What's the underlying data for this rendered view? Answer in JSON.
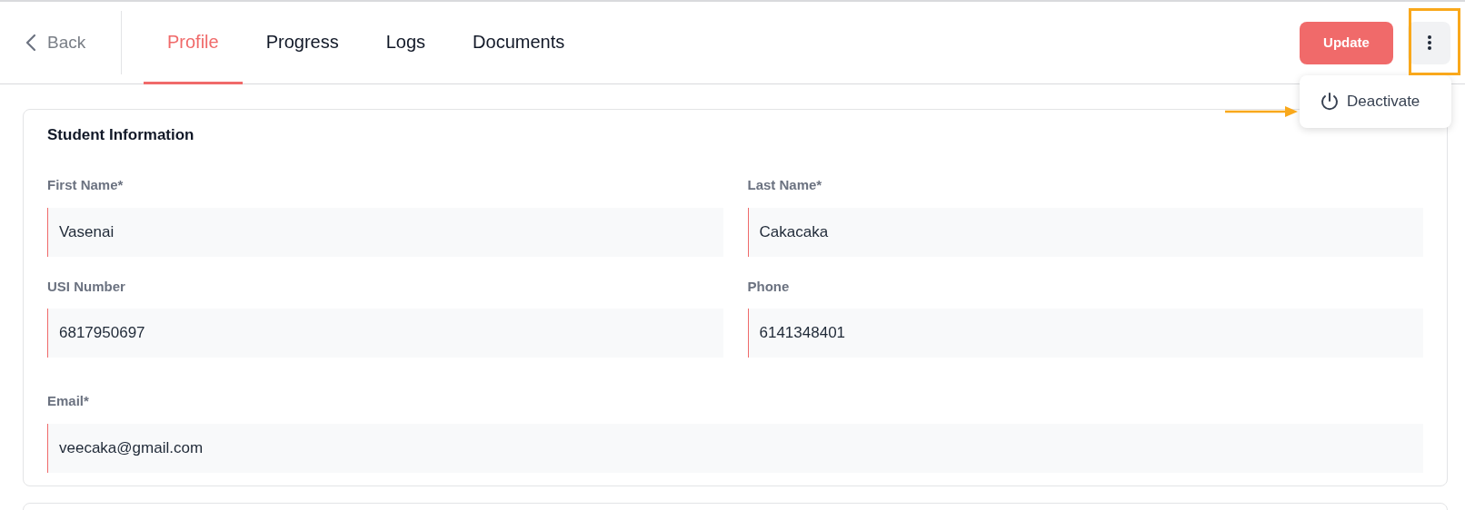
{
  "header": {
    "back": {
      "label": "Back"
    },
    "tabs": [
      {
        "label": "Profile",
        "selected": true
      },
      {
        "label": "Progress",
        "selected": false
      },
      {
        "label": "Logs",
        "selected": false
      },
      {
        "label": "Documents",
        "selected": false
      }
    ],
    "update_button": {
      "label": "Update"
    },
    "menu": {
      "expanded": true,
      "items": [
        {
          "label": "Deactivate"
        }
      ]
    }
  },
  "card": {
    "title": "Student Information",
    "fields": [
      {
        "label": "First Name*",
        "value": "Vasenai"
      },
      {
        "label": "Last Name*",
        "value": "Cakacaka"
      },
      {
        "label": "USI Number",
        "value": "6817950697"
      },
      {
        "label": "Phone",
        "value": "6141348401"
      },
      {
        "label": "Email*",
        "value": "veecaka@gmail.com"
      }
    ]
  }
}
